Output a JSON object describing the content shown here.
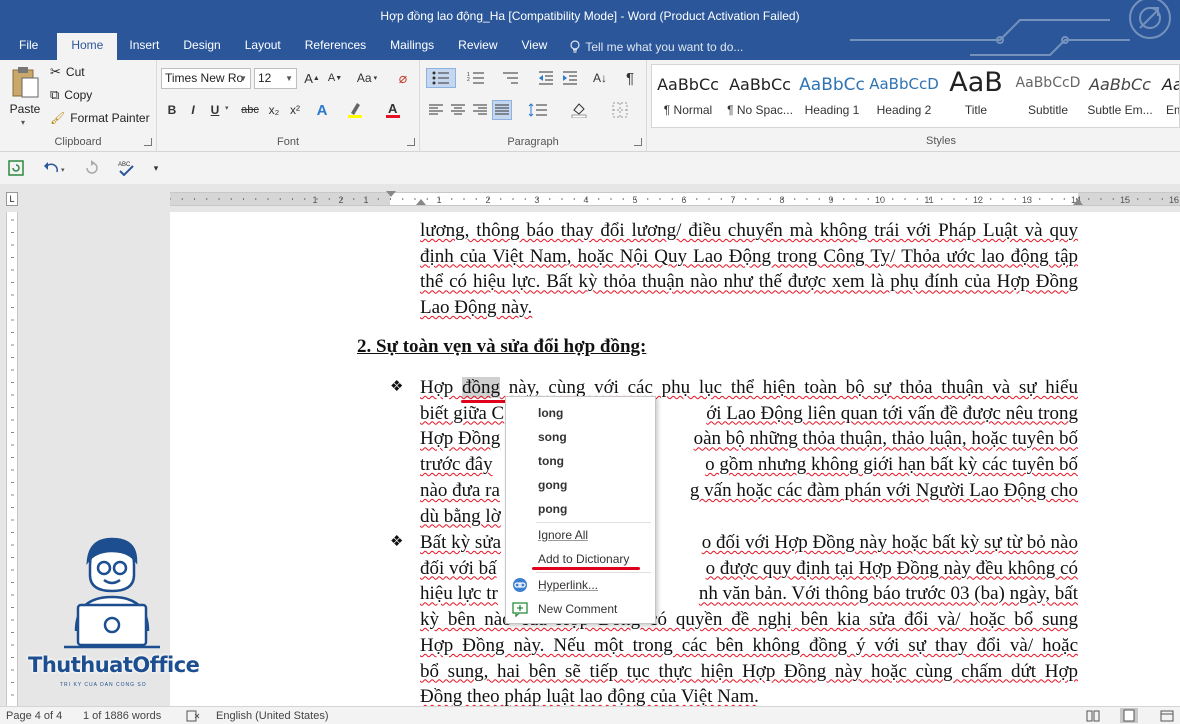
{
  "window": {
    "title": "Hợp đồng lao động_Ha [Compatibility Mode] - Word (Product Activation Failed)"
  },
  "tabs": [
    {
      "label": "File"
    },
    {
      "label": "Home",
      "active": true
    },
    {
      "label": "Insert"
    },
    {
      "label": "Design"
    },
    {
      "label": "Layout"
    },
    {
      "label": "References"
    },
    {
      "label": "Mailings"
    },
    {
      "label": "Review"
    },
    {
      "label": "View"
    }
  ],
  "tell_me": {
    "placeholder": "Tell me what you want to do..."
  },
  "ribbon": {
    "clipboard": {
      "paste": "Paste",
      "cut": "Cut",
      "copy": "Copy",
      "format_painter": "Format Painter",
      "label": "Clipboard"
    },
    "font": {
      "family": "Times New Ro",
      "size": "12",
      "grow": "A",
      "shrink": "A",
      "case": "Aa",
      "bold": "B",
      "italic": "I",
      "underline": "U",
      "strike": "abc",
      "subscript": "x₂",
      "superscript": "x²",
      "label": "Font"
    },
    "paragraph": {
      "label": "Paragraph"
    },
    "styles": {
      "label": "Styles",
      "items": [
        {
          "preview": "AaBbCc",
          "name": "¶ Normal"
        },
        {
          "preview": "AaBbCc",
          "name": "¶ No Spac..."
        },
        {
          "preview": "AaBbCc",
          "name": "Heading 1"
        },
        {
          "preview": "AaBbCcD",
          "name": "Heading 2"
        },
        {
          "preview": "AaB",
          "name": "Title"
        },
        {
          "preview": "AaBbCcD",
          "name": "Subtitle"
        },
        {
          "preview": "AaBbCc",
          "name": "Subtle Em..."
        },
        {
          "preview": "Aa",
          "name": "Em"
        }
      ]
    }
  },
  "ruler": {
    "labels": [
      "1",
      "2",
      "1",
      "1",
      "2",
      "3",
      "4",
      "5",
      "6",
      "7",
      "8",
      "9",
      "10",
      "11",
      "12",
      "13",
      "14",
      "15",
      "16",
      "17"
    ]
  },
  "document": {
    "para1": "lương, thông báo thay đổi lương/ điều chuyển mà không trái với Pháp Luật và quy định của Việt Nam, hoặc Nội Quy Lao Động trong Công Ty/ Thỏa ước lao động tập thể có hiệu lực. Bất kỳ thỏa thuận nào như thế được xem là phụ đính của Hợp Đồng Lao Động này.",
    "heading": "2. Sự toàn vẹn và sửa đổi hợp đồng:",
    "bullet1": {
      "line1_a": "Hợp ",
      "selected_word": "đồng",
      "line1_b": " này, cùng với các phụ lục thể hiện toàn bộ sự thỏa thuận và sự hiểu",
      "line2_a": "biết giữa C",
      "line2_b": "ới Lao Động liên quan tới vấn đề được nêu trong",
      "line3_a": "Hợp Đồng",
      "line3_b": "oàn bộ những thỏa thuận, thảo luận, hoặc tuyên bố",
      "line4_a": "trước đây",
      "line4_b": "o gồm nhưng không giới hạn bất kỳ các tuyên bố",
      "line5_a": "nào đưa ra",
      "line5_b": "g vấn hoặc các đàm phán với Người Lao Động cho",
      "line6_a": "dù bằng lờ"
    },
    "bullet2": {
      "line1_a": "Bất kỳ sửa",
      "line1_b": "o đối với Hợp Đồng này hoặc bất kỳ sự từ bỏ nào",
      "line2_a": "đối với bấ",
      "line2_b": "o được quy định tại Hợp Đồng này đều không có",
      "line3_a": "hiệu lực tr",
      "line3_b": "nh văn bản. Với thông báo trước 03 (ba) ngày, bất",
      "line4": "kỳ bên nào của Hợp Đồng có quyền đề nghị bên kia sửa đổi và/ hoặc bổ sung",
      "line5": "Hợp Đồng này. Nếu một trong các bên không đồng ý với sự thay đổi và/ hoặc",
      "line6": "bổ sung, hai bên sẽ tiếp tục thực hiện Hợp Đồng này hoặc cùng chấm dứt Hợp",
      "line7": "Đồng theo pháp luật lao động của Việt Nam."
    },
    "bullet_symbol": "❖"
  },
  "context_menu": {
    "suggestions": [
      "long",
      "song",
      "tong",
      "gong",
      "pong"
    ],
    "ignore_all": "Ignore All",
    "add_to_dictionary": "Add to Dictionary",
    "hyperlink": "Hyperlink...",
    "new_comment": "New Comment"
  },
  "logo": {
    "text": "ThuthuatOffice",
    "tagline": "TRI KY CUA DAN CONG SO"
  },
  "status_bar": {
    "page": "Page 4 of 4",
    "words": "1 of 1886 words",
    "language": "English (United States)"
  },
  "colors": {
    "title_bar": "#2b579a",
    "ribbon": "#f3f3f3",
    "spelling_underline": "#e81123",
    "highlight_underline": "#e0001b",
    "logo": "#1d4e8f"
  }
}
